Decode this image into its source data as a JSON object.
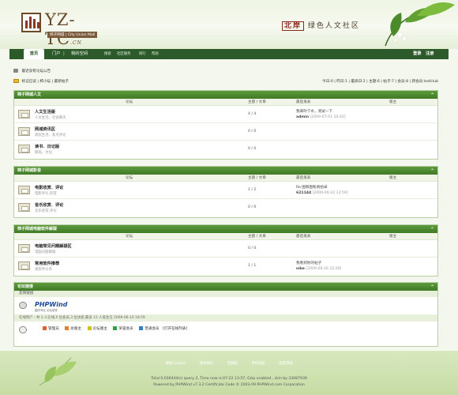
{
  "header": {
    "logo_text": "YZ-TC",
    "logo_suffix": ".CN",
    "logo_sub": "柿子网城 | City Union Mall",
    "slogan_mark": "北岸",
    "slogan": "绿色人文社区"
  },
  "nav": {
    "home": "首页",
    "portal": "门户",
    "myspace": "我的空间",
    "search": "搜索",
    "community": "社区服务",
    "rank": "排行",
    "help": "帮助",
    "login": "登录",
    "register": "注册"
  },
  "announcement": "最近没有论坛公告",
  "toolbar": {
    "mark_read": "标记已读",
    "guild": "柿小坛",
    "latest": "最新帖子",
    "stats": "今日:0 | 昨日:1 | 最高日:2 | 主题:6 | 帖子:7 | 会员:8 | 新会员:leafclub"
  },
  "table_headers": {
    "forum": "论坛",
    "topics": "主题 / 文章",
    "last_post": "最后发表",
    "moderator": "版主"
  },
  "sections": [
    {
      "title": "柿子网城人文",
      "forums": [
        {
          "name": "人文生活版",
          "desc": "人文生活，社会聊天",
          "count": "4 / 4",
          "last_title": "我来吹下水，测试一下",
          "last_user": "admin",
          "last_time": "[2009-07-01 10:03]"
        },
        {
          "name": "网城资讯区",
          "desc": "调侃生活，焦点评论",
          "count": "0 / 0",
          "last_title": "",
          "last_user": "",
          "last_time": ""
        },
        {
          "name": "读书．日记版",
          "desc": "随笔，文化",
          "count": "0 / 0",
          "last_title": "",
          "last_user": "",
          "last_time": ""
        }
      ]
    },
    {
      "title": "柿子网城影音",
      "forums": [
        {
          "name": "电影欣赏．评论",
          "desc": "电影评论,欣赏",
          "count": "1 / 2",
          "last_title": "Re:图粉图粉真给卓",
          "last_user": "621144",
          "last_time": "[2009-06-22 13:59]"
        },
        {
          "name": "音乐欣赏．评论",
          "desc": "音乐欣赏,评论",
          "count": "0 / 0",
          "last_title": "",
          "last_user": "",
          "last_time": ""
        }
      ]
    },
    {
      "title": "柿子网城电脑软件解疑",
      "forums": [
        {
          "name": "电脑常见问题解疑区",
          "desc": "电脑问题解疑",
          "count": "0 / 0",
          "last_title": "",
          "last_user": "",
          "last_time": ""
        },
        {
          "name": "常用软件推荐",
          "desc": "须软件分享",
          "count": "1 / 1",
          "last_title": "我看到你的帖子",
          "last_user": "nike",
          "last_time": "[2009-06-26 22:29]"
        }
      ]
    }
  ],
  "links": {
    "title": "论坛链接",
    "sub": "友情链接",
    "phpwind_logo": "PHPWind",
    "phpwind_tag": "国内专业 论坛软件",
    "online": "在线用户 - 共 3 人在线,0 位会员,3 位访客,最多 12 人发生在 2009-06-10 18:59",
    "legend": [
      "管理员",
      "总版主",
      "论坛版主",
      "荣誉会员",
      "普通会员",
      "[打开在线列表]"
    ]
  },
  "footer": {
    "links": [
      "清除Cookies",
      "联系我们",
      "无图版",
      "手机浏览",
      "返回顶部"
    ],
    "line1": "Total 0.036444(s) query 2, Time now is:07-22 13:57, Gzip enabled , skin by 33087939",
    "line2": "Powered by PHPWind v7.3.2 Certificate Code © 2003-09 PHPWind.com Corporation"
  },
  "colors": {
    "nav_bg": "#2d5a2a",
    "section_head": "#4a8a30",
    "legend": [
      "#e06030",
      "#e08030",
      "#d0c020",
      "#30a040",
      "#3080d0"
    ]
  }
}
